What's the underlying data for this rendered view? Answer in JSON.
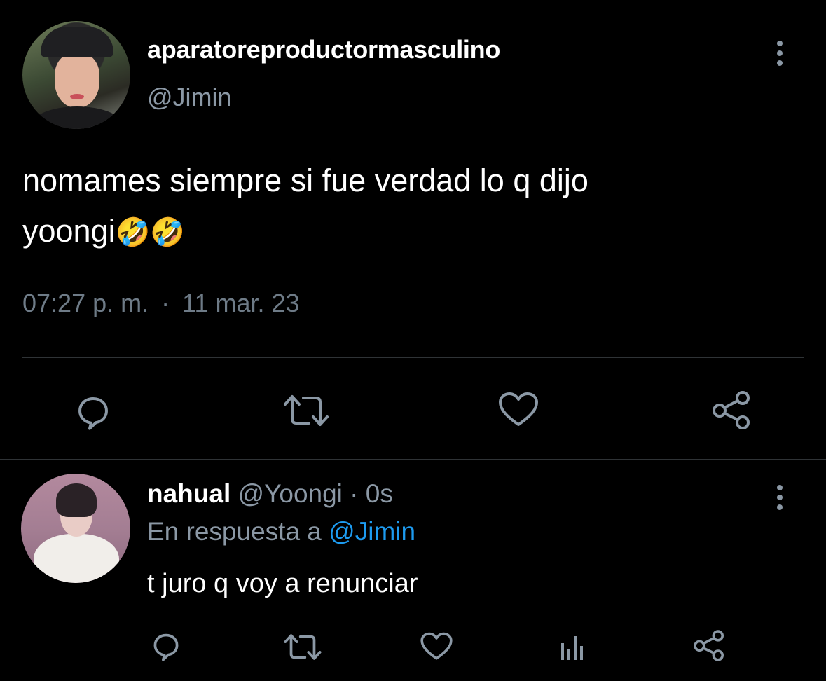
{
  "main_tweet": {
    "display_name": "aparatoreproductormasculino",
    "handle": "@Jimin",
    "text_line1": "nomames siempre si fue verdad lo q dijo",
    "text_line2": "yoongi",
    "emoji": "🤣🤣",
    "time": "07:27 p. m.",
    "separator": "·",
    "date": "11 mar. 23",
    "avatar_icon": "profile-photo",
    "actions": [
      "reply-icon",
      "retweet-icon",
      "like-icon",
      "share-icon"
    ]
  },
  "reply_tweet": {
    "display_name": "nahual",
    "handle": "@Yoongi",
    "separator": " · ",
    "time": "0s",
    "reply_to_label": "En respuesta a ",
    "reply_to_handle": "@Jimin",
    "text": "t juro q voy a renunciar",
    "avatar_icon": "profile-photo",
    "actions": [
      "reply-icon",
      "retweet-icon",
      "like-icon",
      "analytics-icon",
      "share-icon"
    ]
  },
  "colors": {
    "background": "#000000",
    "primary_text": "#ffffff",
    "secondary_text": "#8b98a5",
    "link": "#1d9bf0",
    "divider": "#2f3336"
  }
}
